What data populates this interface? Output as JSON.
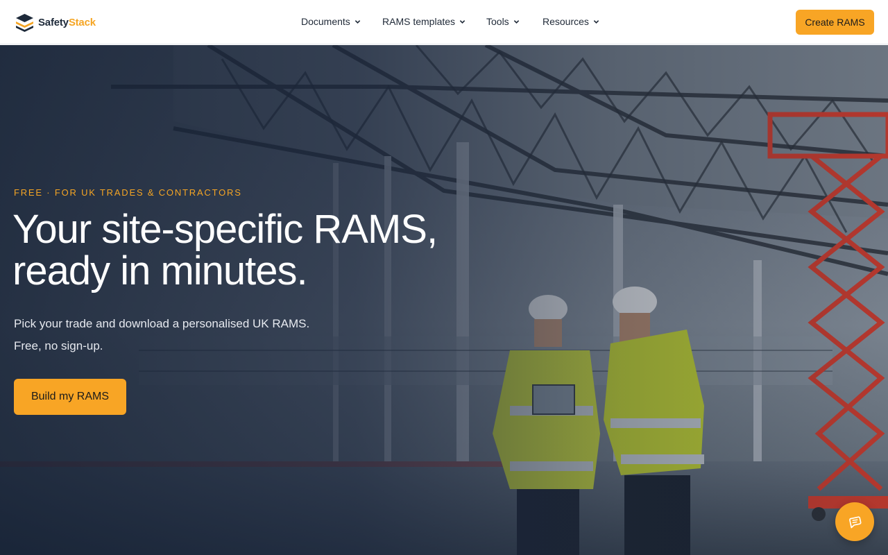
{
  "brand": {
    "part1": "Safety",
    "part2": "Stack",
    "accent": "#f8a525",
    "dark": "#1e2a3a"
  },
  "nav": {
    "items": [
      {
        "label": "Documents"
      },
      {
        "label": "RAMS templates"
      },
      {
        "label": "Tools"
      },
      {
        "label": "Resources"
      }
    ],
    "cta_label": "Create RAMS"
  },
  "hero": {
    "eyebrow": "FREE · FOR UK TRADES & CONTRACTORS",
    "headline_line1": "Your site-specific RAMS,",
    "headline_line2": "ready in minutes.",
    "subtext_line1": "Pick your trade and download a personalised UK RAMS.",
    "subtext_line2": "Free, no sign-up.",
    "button_label": "Build my RAMS",
    "background": "construction-site-photo"
  },
  "chat": {
    "icon": "chat-icon"
  }
}
